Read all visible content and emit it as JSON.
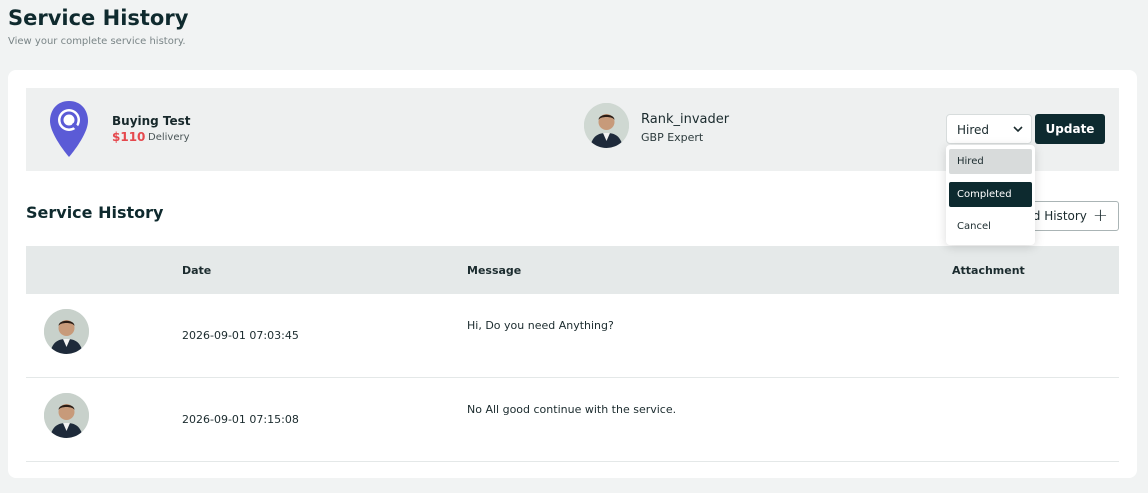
{
  "page": {
    "title": "Service History",
    "subtitle": "View your complete service history."
  },
  "service": {
    "icon": "location-search-icon",
    "name": "Buying Test",
    "price": "$110",
    "type": "Delivery"
  },
  "expert": {
    "name": "Rank_invader",
    "role": "GBP Expert"
  },
  "status": {
    "selected": "Hired",
    "options": [
      "Hired",
      "Completed",
      "Cancel"
    ],
    "update_label": "Update"
  },
  "history": {
    "title": "Service History",
    "add_label": "ld History",
    "columns": [
      "Date",
      "Message",
      "Attachment"
    ],
    "rows": [
      {
        "date": "2026-09-01 07:03:45",
        "message": "Hi, Do you need Anything?",
        "attachment": ""
      },
      {
        "date": "2026-09-01 07:15:08",
        "message": "No All good continue with the service.",
        "attachment": ""
      }
    ]
  },
  "colors": {
    "primary": "#0d2a2f",
    "price": "#e5484d",
    "icon": "#5b5bd6"
  }
}
